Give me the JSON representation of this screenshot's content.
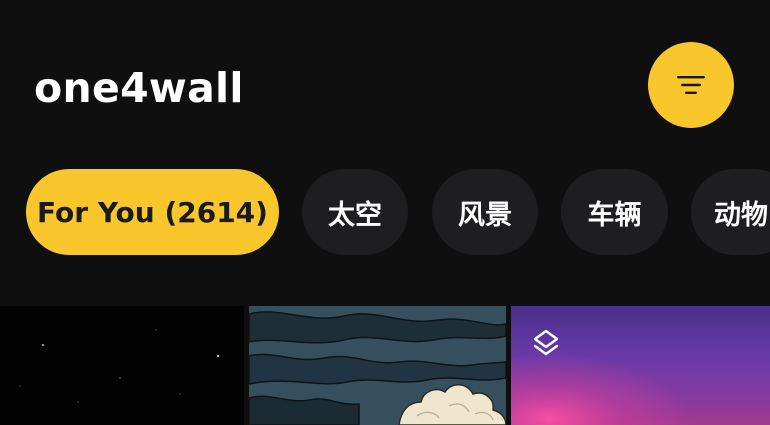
{
  "header": {
    "app_title": "one4wall"
  },
  "menu": {
    "icon": "menu-icon"
  },
  "categories": [
    {
      "label": "For You (2614)",
      "active": true
    },
    {
      "label": "太空",
      "active": false
    },
    {
      "label": "风景",
      "active": false
    },
    {
      "label": "车辆",
      "active": false
    },
    {
      "label": "动物",
      "active": false
    }
  ],
  "wallpapers": [
    {
      "theme": "starry night",
      "badge": null
    },
    {
      "theme": "clouds illustration",
      "badge": null
    },
    {
      "theme": "purple sunset",
      "badge": "layers-icon"
    }
  ],
  "colors": {
    "background": "#0f0f10",
    "accent": "#f9c72c",
    "chip_background": "#1e1e20",
    "text_primary": "#ffffff"
  }
}
